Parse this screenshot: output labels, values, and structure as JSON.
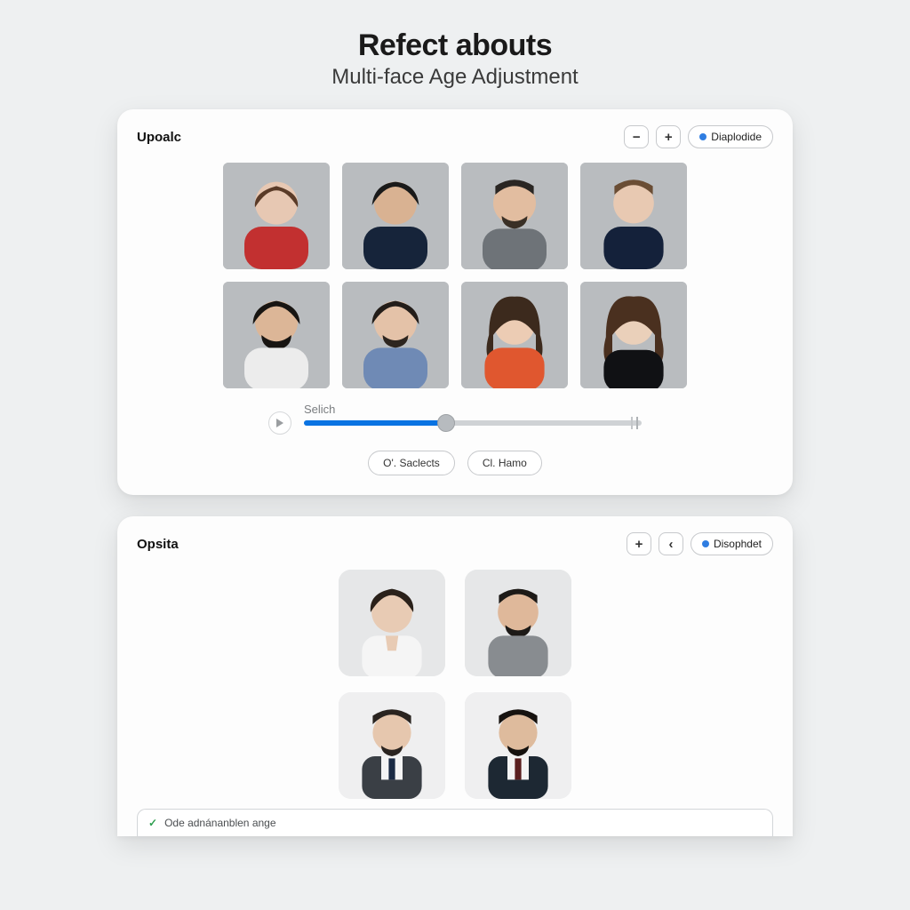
{
  "header": {
    "title": "Refect abouts",
    "subtitle": "Multi-face Age Adjustment"
  },
  "panel1": {
    "title": "Upoalc",
    "actions": {
      "minus_label": "−",
      "plus_label": "+",
      "download_label": "Diaplodide"
    },
    "slider": {
      "label": "Selich"
    },
    "buttons": {
      "left": "O'. Saclects",
      "right": "Cl. Hamo"
    },
    "faces": [
      {
        "id": "face-1"
      },
      {
        "id": "face-2"
      },
      {
        "id": "face-3"
      },
      {
        "id": "face-4"
      },
      {
        "id": "face-5"
      },
      {
        "id": "face-6"
      },
      {
        "id": "face-7"
      },
      {
        "id": "face-8"
      }
    ]
  },
  "panel2": {
    "title": "Opsita",
    "actions": {
      "plus_label": "+",
      "arrow_label": "‹",
      "download_label": "Disophdet"
    },
    "faces": [
      {
        "id": "res-1"
      },
      {
        "id": "res-2"
      },
      {
        "id": "res-3"
      },
      {
        "id": "res-4"
      }
    ],
    "notice": "Ode adnánanblen ange"
  }
}
